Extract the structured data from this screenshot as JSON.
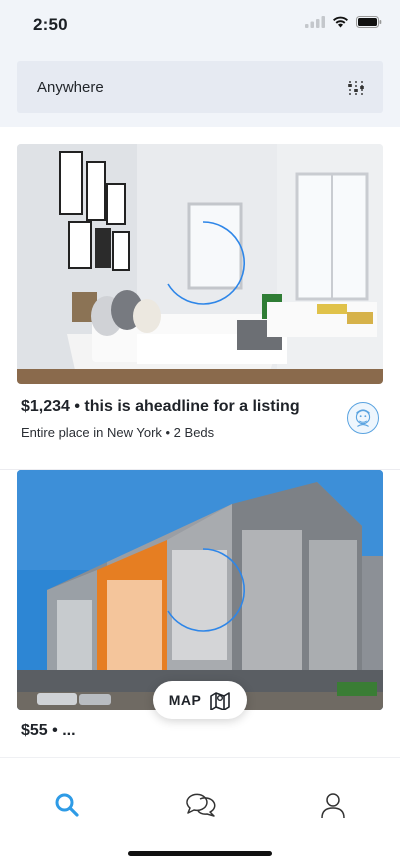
{
  "status_bar": {
    "time": "2:50"
  },
  "search": {
    "value": "Anywhere",
    "filter_icon": "sliders-icon"
  },
  "listings": [
    {
      "title": "$1,234 • this is aheadline for a listing",
      "subtitle": "Entire place in New York • 2 Beds",
      "image_subject": "bedroom",
      "host_icon": "host-avatar"
    },
    {
      "title": "$55 • ...",
      "subtitle": "",
      "image_subject": "apartment-building"
    }
  ],
  "map_button": {
    "label": "MAP",
    "icon": "map-icon"
  },
  "tabs": [
    {
      "name": "search",
      "icon": "search-icon",
      "active": true
    },
    {
      "name": "messages",
      "icon": "chat-icon",
      "active": false
    },
    {
      "name": "profile",
      "icon": "person-icon",
      "active": false
    }
  ],
  "colors": {
    "accent": "#2e9be6",
    "background": "#f1f4f9",
    "search_field": "#e6eaf2"
  }
}
